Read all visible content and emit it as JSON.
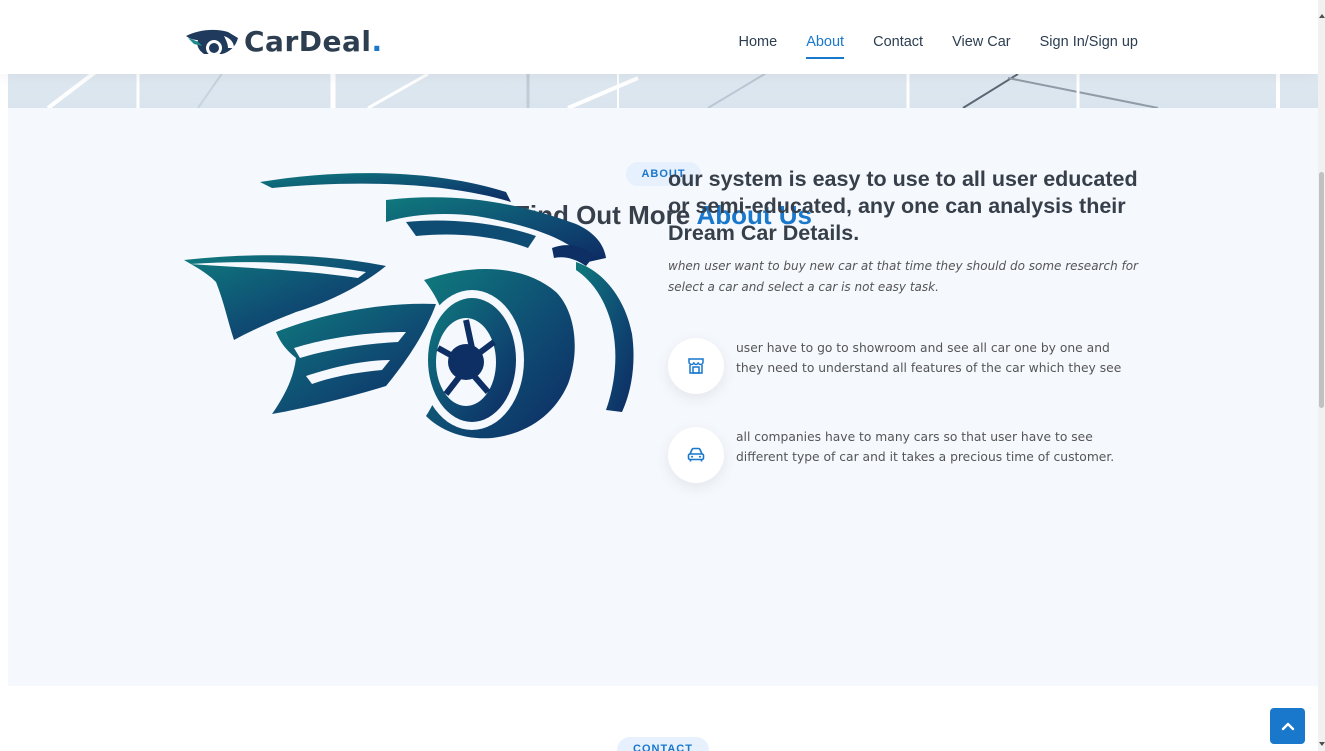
{
  "header": {
    "logo_text": "CarDeal",
    "logo_dot": ".",
    "nav": [
      {
        "label": "Home",
        "active": false
      },
      {
        "label": "About",
        "active": true
      },
      {
        "label": "Contact",
        "active": false
      },
      {
        "label": "View Car",
        "active": false
      },
      {
        "label": "Sign In/Sign up",
        "active": false
      }
    ]
  },
  "about": {
    "badge": "ABOUT",
    "title_prefix": "Find Out More ",
    "title_accent": "About Us",
    "lead": "our system is easy to use to all user educated or semi-educated, any one can analysis their Dream Car Details.",
    "intro": "when user want to buy new car at that time they should do some research for select a car and select a car is not easy task.",
    "features": [
      {
        "icon": "store-icon",
        "text": "user have to go to showroom and see all car one by one and they need to understand all features of the car which they see"
      },
      {
        "icon": "car-front-icon",
        "text": "all companies have to many cars so that user have to see different type of car and it takes a precious time of customer."
      }
    ]
  },
  "contact": {
    "badge": "CONTACT"
  },
  "colors": {
    "accent": "#1977cc",
    "heading": "#37404a",
    "section_bg": "#f5f8fd",
    "badge_bg": "#e7f1fd",
    "car_teal": "#0f7a7d",
    "car_navy": "#0d2f63"
  },
  "icons": {
    "scroll_top": "chevron-up-icon"
  }
}
